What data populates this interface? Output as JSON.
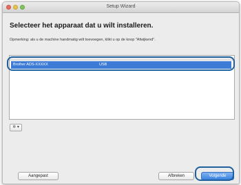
{
  "window": {
    "title": "Setup Wizard"
  },
  "content": {
    "heading": "Selecteer het apparaat dat u wilt installeren.",
    "note": "Opmerking: als u de machine handmatig wilt toevoegen, klikt u op de knop \"Afwijkend\"."
  },
  "device_list": {
    "rows": [
      {
        "name": "Brother ADS-XXXXX",
        "connection": "USB",
        "selected": true
      }
    ]
  },
  "actions_menu": {
    "icon": "gear-icon",
    "label": "✲ ▾"
  },
  "buttons": {
    "custom": "Aangepast",
    "cancel": "Afbreken",
    "next": "Volgende"
  },
  "colors": {
    "selection": "#3d7bd6",
    "highlight_outline": "#1e5f9e",
    "primary_button": "#3b83e0"
  }
}
